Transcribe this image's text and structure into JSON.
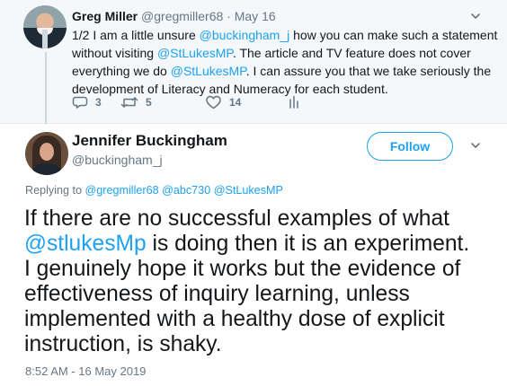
{
  "parent_tweet": {
    "name": "Greg Miller",
    "handle": "@gregmiller68",
    "separator": " · ",
    "date": "May 16",
    "text_lines": [
      [
        {
          "text": "1/2 I am a little unsure ",
          "mention": false
        },
        {
          "text": "@buckingham_j",
          "mention": true
        },
        {
          "text": " how you can make such a statement",
          "mention": false
        }
      ],
      [
        {
          "text": "without visiting ",
          "mention": false
        },
        {
          "text": "@StLukesMP",
          "mention": true
        },
        {
          "text": ". The article and TV feature does not cover",
          "mention": false
        }
      ],
      [
        {
          "text": "everything we do ",
          "mention": false
        },
        {
          "text": "@StLukesMP",
          "mention": true
        },
        {
          "text": ". I can assure you that we take seriously the",
          "mention": false
        }
      ],
      [
        {
          "text": "development of Literacy and Numeracy for each student.",
          "mention": false
        }
      ]
    ],
    "actions": {
      "reply_count": "3",
      "retweet_count": "5",
      "like_count": "14"
    },
    "icons": {
      "menu": "chevron-down-icon",
      "reply": "reply-icon",
      "retweet": "retweet-icon",
      "like": "heart-icon",
      "stats": "stats-icon"
    }
  },
  "main_tweet": {
    "name": "Jennifer Buckingham",
    "handle": "@buckingham_j",
    "follow_label": "Follow",
    "replying_prefix": "Replying to ",
    "replying_to": "@gregmiller68 @abc730 @StLukesMP",
    "body_lines": [
      [
        {
          "text": "If there are no successful examples of what",
          "mention": false
        }
      ],
      [
        {
          "text": "@stlukesMp",
          "mention": true
        },
        {
          "text": " is doing then it is an experiment.",
          "mention": false
        }
      ],
      [
        {
          "text": "I genuinely hope it works but the evidence of",
          "mention": false
        }
      ],
      [
        {
          "text": "effectiveness of inquiry learning, unless",
          "mention": false
        }
      ],
      [
        {
          "text": "implemented with a healthy dose of explicit",
          "mention": false
        }
      ],
      [
        {
          "text": "instruction, is shaky.",
          "mention": false
        }
      ]
    ],
    "timestamp": "8:52 AM - 16 May 2019"
  },
  "colors": {
    "background": "#ffffff",
    "parent_background": "#f5f8fa",
    "text": "#14171a",
    "secondary_text": "#657786",
    "accent": "#1da1f2",
    "divider": "#e6ecf0"
  }
}
